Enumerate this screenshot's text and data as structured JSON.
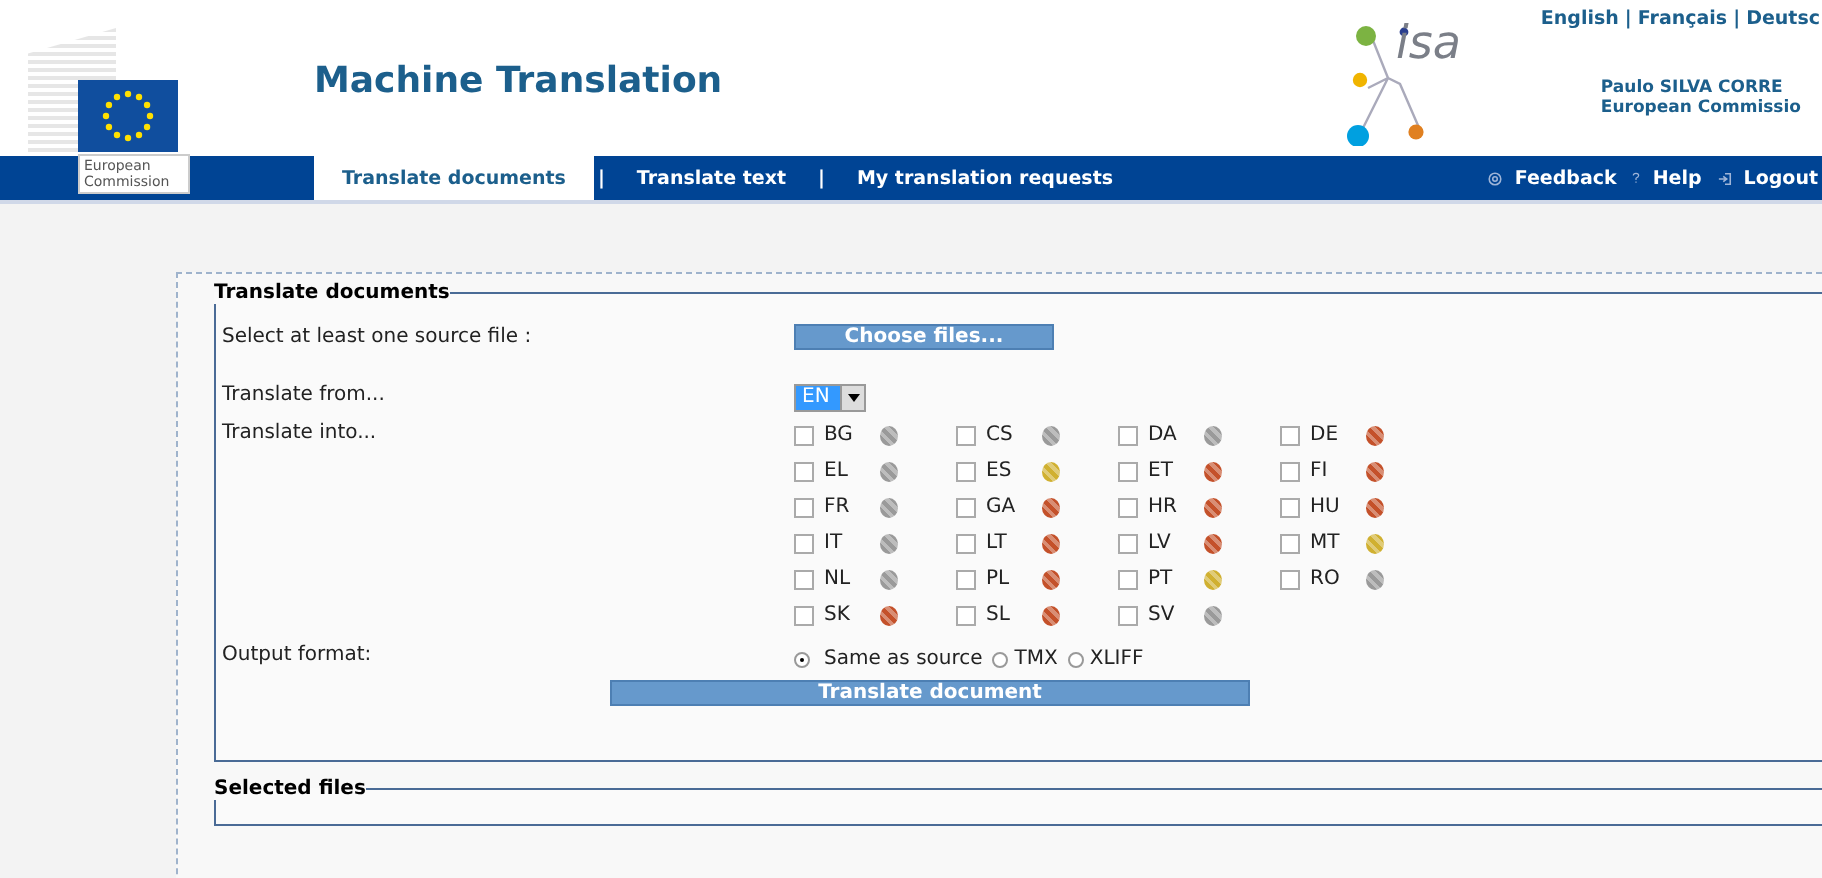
{
  "header": {
    "logo_caption": [
      "European",
      "Commission"
    ],
    "title": "Machine Translation",
    "partner_logo_text": "isa",
    "languages": [
      "English",
      "Français",
      "Deutsc"
    ],
    "user": {
      "name": "Paulo SILVA CORRE",
      "organisation": "European Commissio"
    }
  },
  "nav": {
    "tabs": [
      {
        "label": "Translate documents",
        "selected": true
      },
      {
        "label": "Translate text",
        "selected": false
      },
      {
        "label": "My translation requests",
        "selected": false
      }
    ],
    "separator": "|",
    "links": [
      {
        "label": "Feedback"
      },
      {
        "label": "Help"
      },
      {
        "label": "Logout"
      }
    ]
  },
  "form": {
    "legend": "Translate documents",
    "source_label": "Select at least one source file :",
    "choose_button": "Choose files...",
    "from_label": "Translate from...",
    "from_value": "EN",
    "into_label": "Translate into...",
    "languages": [
      {
        "code": "BG",
        "checked": false,
        "color": "#9a9a9a"
      },
      {
        "code": "CS",
        "checked": false,
        "color": "#9a9a9a"
      },
      {
        "code": "DA",
        "checked": false,
        "color": "#9a9a9a"
      },
      {
        "code": "DE",
        "checked": false,
        "color": "#c4512a"
      },
      {
        "code": "EL",
        "checked": false,
        "color": "#9a9a9a"
      },
      {
        "code": "ES",
        "checked": false,
        "color": "#d0b030"
      },
      {
        "code": "ET",
        "checked": false,
        "color": "#c4512a"
      },
      {
        "code": "FI",
        "checked": false,
        "color": "#c4512a"
      },
      {
        "code": "FR",
        "checked": false,
        "color": "#9a9a9a"
      },
      {
        "code": "GA",
        "checked": false,
        "color": "#c4512a"
      },
      {
        "code": "HR",
        "checked": false,
        "color": "#c4512a"
      },
      {
        "code": "HU",
        "checked": false,
        "color": "#c4512a"
      },
      {
        "code": "IT",
        "checked": false,
        "color": "#9a9a9a"
      },
      {
        "code": "LT",
        "checked": false,
        "color": "#c4512a"
      },
      {
        "code": "LV",
        "checked": false,
        "color": "#c4512a"
      },
      {
        "code": "MT",
        "checked": false,
        "color": "#d0b030"
      },
      {
        "code": "NL",
        "checked": false,
        "color": "#9a9a9a"
      },
      {
        "code": "PL",
        "checked": false,
        "color": "#c4512a"
      },
      {
        "code": "PT",
        "checked": false,
        "color": "#d0b030"
      },
      {
        "code": "RO",
        "checked": false,
        "color": "#9a9a9a"
      },
      {
        "code": "SK",
        "checked": false,
        "color": "#c4512a"
      },
      {
        "code": "SL",
        "checked": false,
        "color": "#c4512a"
      },
      {
        "code": "SV",
        "checked": false,
        "color": "#9a9a9a"
      }
    ],
    "output_label": "Output format:",
    "output_formats": [
      {
        "label": "Same as source",
        "selected": true
      },
      {
        "label": "TMX",
        "selected": false
      },
      {
        "label": "XLIFF",
        "selected": false
      }
    ],
    "submit_button": "Translate document"
  },
  "selected_files": {
    "legend": "Selected files"
  }
}
